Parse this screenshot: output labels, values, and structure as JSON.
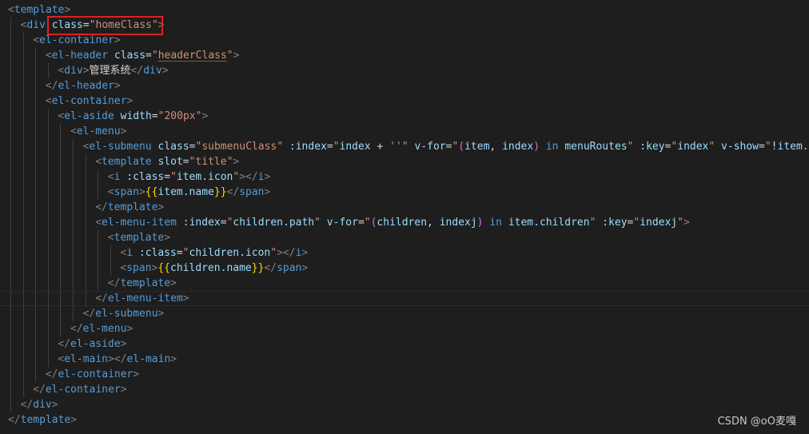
{
  "code_lines": [
    {
      "indent": 0,
      "tokens": [
        [
          "br",
          "<"
        ],
        [
          "tag",
          "template"
        ],
        [
          "br",
          ">"
        ]
      ]
    },
    {
      "indent": 1,
      "tokens": [
        [
          "br",
          "<"
        ],
        [
          "tag",
          "div"
        ],
        [
          "sp",
          " "
        ],
        [
          "attr",
          "class"
        ],
        [
          "eq",
          "="
        ],
        [
          "str",
          "\"homeClass\""
        ],
        [
          "br",
          ">"
        ]
      ]
    },
    {
      "indent": 2,
      "tokens": [
        [
          "br",
          "<"
        ],
        [
          "tag",
          "el-container"
        ],
        [
          "br",
          ">"
        ]
      ]
    },
    {
      "indent": 3,
      "tokens": [
        [
          "br",
          "<"
        ],
        [
          "tag",
          "el-header"
        ],
        [
          "sp",
          " "
        ],
        [
          "attr",
          "class"
        ],
        [
          "eq",
          "="
        ],
        [
          "str",
          "\""
        ],
        [
          "strU",
          "headerClass"
        ],
        [
          "str",
          "\""
        ],
        [
          "br",
          ">"
        ]
      ]
    },
    {
      "indent": 4,
      "tokens": [
        [
          "br",
          "<"
        ],
        [
          "tag",
          "div"
        ],
        [
          "br",
          ">"
        ],
        [
          "txt",
          "管理系统"
        ],
        [
          "br",
          "</"
        ],
        [
          "tag",
          "div"
        ],
        [
          "br",
          ">"
        ]
      ]
    },
    {
      "indent": 3,
      "tokens": [
        [
          "br",
          "</"
        ],
        [
          "tag",
          "el-header"
        ],
        [
          "br",
          ">"
        ]
      ]
    },
    {
      "indent": 3,
      "tokens": [
        [
          "br",
          "<"
        ],
        [
          "tag",
          "el-container"
        ],
        [
          "br",
          ">"
        ]
      ]
    },
    {
      "indent": 4,
      "tokens": [
        [
          "br",
          "<"
        ],
        [
          "tag",
          "el-aside"
        ],
        [
          "sp",
          " "
        ],
        [
          "attr",
          "width"
        ],
        [
          "eq",
          "="
        ],
        [
          "str",
          "\"200px\""
        ],
        [
          "br",
          ">"
        ]
      ]
    },
    {
      "indent": 5,
      "tokens": [
        [
          "br",
          "<"
        ],
        [
          "tag",
          "el-menu"
        ],
        [
          "br",
          ">"
        ]
      ]
    },
    {
      "indent": 6,
      "tokens": [
        [
          "br",
          "<"
        ],
        [
          "tag",
          "el-submenu"
        ],
        [
          "sp",
          " "
        ],
        [
          "attr",
          "class"
        ],
        [
          "eq",
          "="
        ],
        [
          "str",
          "\"submenuClass\""
        ],
        [
          "sp",
          " "
        ],
        [
          "attr",
          ":index"
        ],
        [
          "eq",
          "="
        ],
        [
          "str",
          "\""
        ],
        [
          "var",
          "index"
        ],
        [
          "txt",
          " + "
        ],
        [
          "str",
          "''"
        ],
        [
          "str",
          "\""
        ],
        [
          "sp",
          " "
        ],
        [
          "attr",
          "v-for"
        ],
        [
          "eq",
          "="
        ],
        [
          "str",
          "\""
        ],
        [
          "paren",
          "("
        ],
        [
          "var",
          "item"
        ],
        [
          "txt",
          ", "
        ],
        [
          "var",
          "index"
        ],
        [
          "paren",
          ")"
        ],
        [
          "sp",
          " "
        ],
        [
          "kw",
          "in"
        ],
        [
          "sp",
          " "
        ],
        [
          "var",
          "menuRoutes"
        ],
        [
          "str",
          "\""
        ],
        [
          "sp",
          " "
        ],
        [
          "attr",
          ":key"
        ],
        [
          "eq",
          "="
        ],
        [
          "str",
          "\""
        ],
        [
          "var",
          "index"
        ],
        [
          "str",
          "\""
        ],
        [
          "sp",
          " "
        ],
        [
          "attr",
          "v-show"
        ],
        [
          "eq",
          "="
        ],
        [
          "str",
          "\""
        ],
        [
          "txt",
          "!"
        ],
        [
          "var",
          "item.hi"
        ]
      ]
    },
    {
      "indent": 7,
      "tokens": [
        [
          "br",
          "<"
        ],
        [
          "tag",
          "template"
        ],
        [
          "sp",
          " "
        ],
        [
          "attr",
          "slot"
        ],
        [
          "eq",
          "="
        ],
        [
          "str",
          "\"title\""
        ],
        [
          "br",
          ">"
        ]
      ]
    },
    {
      "indent": 8,
      "tokens": [
        [
          "br",
          "<"
        ],
        [
          "tag",
          "i"
        ],
        [
          "sp",
          " "
        ],
        [
          "attr",
          ":class"
        ],
        [
          "eq",
          "="
        ],
        [
          "str",
          "\""
        ],
        [
          "var",
          "item.icon"
        ],
        [
          "str",
          "\""
        ],
        [
          "br",
          ">"
        ],
        [
          "br",
          "</"
        ],
        [
          "tag",
          "i"
        ],
        [
          "br",
          ">"
        ]
      ]
    },
    {
      "indent": 8,
      "tokens": [
        [
          "br",
          "<"
        ],
        [
          "tag",
          "span"
        ],
        [
          "br",
          ">"
        ],
        [
          "brace",
          "{{"
        ],
        [
          "var",
          "item.name"
        ],
        [
          "brace",
          "}}"
        ],
        [
          "br",
          "</"
        ],
        [
          "tag",
          "span"
        ],
        [
          "br",
          ">"
        ]
      ]
    },
    {
      "indent": 7,
      "tokens": [
        [
          "br",
          "</"
        ],
        [
          "tag",
          "template"
        ],
        [
          "br",
          ">"
        ]
      ]
    },
    {
      "indent": 7,
      "tokens": [
        [
          "br",
          "<"
        ],
        [
          "tag",
          "el-menu-item"
        ],
        [
          "sp",
          " "
        ],
        [
          "attr",
          ":index"
        ],
        [
          "eq",
          "="
        ],
        [
          "str",
          "\""
        ],
        [
          "var",
          "children.path"
        ],
        [
          "str",
          "\""
        ],
        [
          "sp",
          " "
        ],
        [
          "attr",
          "v-for"
        ],
        [
          "eq",
          "="
        ],
        [
          "str",
          "\""
        ],
        [
          "paren",
          "("
        ],
        [
          "var",
          "children"
        ],
        [
          "txt",
          ", "
        ],
        [
          "var",
          "indexj"
        ],
        [
          "paren",
          ")"
        ],
        [
          "sp",
          " "
        ],
        [
          "kw",
          "in"
        ],
        [
          "sp",
          " "
        ],
        [
          "var",
          "item.children"
        ],
        [
          "str",
          "\""
        ],
        [
          "sp",
          " "
        ],
        [
          "attr",
          ":key"
        ],
        [
          "eq",
          "="
        ],
        [
          "str",
          "\""
        ],
        [
          "var",
          "indexj"
        ],
        [
          "str",
          "\""
        ],
        [
          "br",
          ">"
        ]
      ]
    },
    {
      "indent": 8,
      "tokens": [
        [
          "br",
          "<"
        ],
        [
          "tag",
          "template"
        ],
        [
          "br",
          ">"
        ]
      ]
    },
    {
      "indent": 9,
      "tokens": [
        [
          "br",
          "<"
        ],
        [
          "tag",
          "i"
        ],
        [
          "sp",
          " "
        ],
        [
          "attr",
          ":class"
        ],
        [
          "eq",
          "="
        ],
        [
          "str",
          "\""
        ],
        [
          "var",
          "children.icon"
        ],
        [
          "str",
          "\""
        ],
        [
          "br",
          ">"
        ],
        [
          "br",
          "</"
        ],
        [
          "tag",
          "i"
        ],
        [
          "br",
          ">"
        ]
      ]
    },
    {
      "indent": 9,
      "tokens": [
        [
          "br",
          "<"
        ],
        [
          "tag",
          "span"
        ],
        [
          "br",
          ">"
        ],
        [
          "brace",
          "{{"
        ],
        [
          "var",
          "children.name"
        ],
        [
          "brace",
          "}}"
        ],
        [
          "br",
          "</"
        ],
        [
          "tag",
          "span"
        ],
        [
          "br",
          ">"
        ]
      ]
    },
    {
      "indent": 8,
      "tokens": [
        [
          "br",
          "</"
        ],
        [
          "tag",
          "template"
        ],
        [
          "br",
          ">"
        ]
      ]
    },
    {
      "indent": 7,
      "tokens": [
        [
          "br",
          "</"
        ],
        [
          "tag",
          "el-menu-item"
        ],
        [
          "br",
          ">"
        ]
      ],
      "current": true
    },
    {
      "indent": 6,
      "tokens": [
        [
          "br",
          "</"
        ],
        [
          "tag",
          "el-submenu"
        ],
        [
          "br",
          ">"
        ]
      ]
    },
    {
      "indent": 5,
      "tokens": [
        [
          "br",
          "</"
        ],
        [
          "tag",
          "el-menu"
        ],
        [
          "br",
          ">"
        ]
      ]
    },
    {
      "indent": 4,
      "tokens": [
        [
          "br",
          "</"
        ],
        [
          "tag",
          "el-aside"
        ],
        [
          "br",
          ">"
        ]
      ]
    },
    {
      "indent": 4,
      "tokens": [
        [
          "br",
          "<"
        ],
        [
          "tag",
          "el-main"
        ],
        [
          "br",
          ">"
        ],
        [
          "br",
          "</"
        ],
        [
          "tag",
          "el-main"
        ],
        [
          "br",
          ">"
        ]
      ]
    },
    {
      "indent": 3,
      "tokens": [
        [
          "br",
          "</"
        ],
        [
          "tag",
          "el-container"
        ],
        [
          "br",
          ">"
        ]
      ]
    },
    {
      "indent": 2,
      "tokens": [
        [
          "br",
          "</"
        ],
        [
          "tag",
          "el-container"
        ],
        [
          "br",
          ">"
        ]
      ]
    },
    {
      "indent": 1,
      "tokens": [
        [
          "br",
          "</"
        ],
        [
          "tag",
          "div"
        ],
        [
          "br",
          ">"
        ]
      ]
    },
    {
      "indent": 0,
      "tokens": [
        [
          "br",
          "</"
        ],
        [
          "tag",
          "template"
        ],
        [
          "br",
          ">"
        ]
      ]
    }
  ],
  "highlight": {
    "label": "class=\"homeClass\"",
    "color": "#e02020"
  },
  "watermark": "CSDN @oO麦嘎",
  "colors": {
    "background": "#1e1e1e",
    "tag": "#569cd6",
    "attribute": "#9cdcfe",
    "string": "#ce9178",
    "bracket": "#808080",
    "text": "#d4d4d4"
  }
}
